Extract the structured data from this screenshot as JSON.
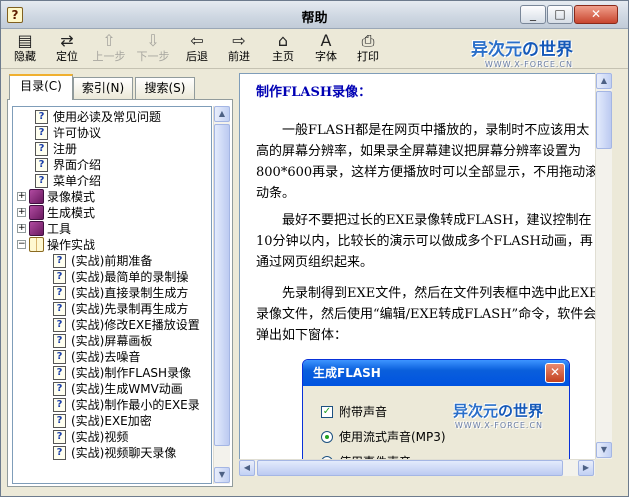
{
  "window": {
    "title": "帮助",
    "minimize": "_",
    "maximize": "□",
    "close": "✕"
  },
  "toolbar": [
    {
      "label": "隐藏",
      "icon": "hide-icon",
      "glyph": "▤",
      "enabled": true
    },
    {
      "label": "定位",
      "icon": "locate-icon",
      "glyph": "⇄",
      "enabled": true
    },
    {
      "label": "上一步",
      "icon": "up-arrow-icon",
      "glyph": "⇧",
      "enabled": false
    },
    {
      "label": "下一步",
      "icon": "down-arrow-icon",
      "glyph": "⇩",
      "enabled": false
    },
    {
      "label": "后退",
      "icon": "back-arrow-icon",
      "glyph": "⇦",
      "enabled": true
    },
    {
      "label": "前进",
      "icon": "forward-arrow-icon",
      "glyph": "⇨",
      "enabled": true
    },
    {
      "label": "主页",
      "icon": "home-icon",
      "glyph": "⌂",
      "enabled": true
    },
    {
      "label": "字体",
      "icon": "font-icon",
      "glyph": "A",
      "enabled": true
    },
    {
      "label": "打印",
      "icon": "printer-icon",
      "glyph": "⎙",
      "enabled": true
    }
  ],
  "watermark": {
    "text_a": "异次元",
    "text_b": "の世界",
    "sub": "WWW.X-FORCE.CN"
  },
  "tabs": [
    {
      "label": "目录(C)",
      "active": true
    },
    {
      "label": "索引(N)",
      "active": false
    },
    {
      "label": "搜索(S)",
      "active": false
    }
  ],
  "tree": [
    {
      "level": 1,
      "type": "page",
      "label": "使用必读及常见问题"
    },
    {
      "level": 1,
      "type": "page",
      "label": "许可协议"
    },
    {
      "level": 1,
      "type": "page",
      "label": "注册"
    },
    {
      "level": 1,
      "type": "page",
      "label": "界面介绍"
    },
    {
      "level": 1,
      "type": "page",
      "label": "菜单介绍"
    },
    {
      "level": 0,
      "type": "book",
      "label": "录像模式",
      "expander": "+"
    },
    {
      "level": 0,
      "type": "book",
      "label": "生成模式",
      "expander": "+"
    },
    {
      "level": 0,
      "type": "book",
      "label": "工具",
      "expander": "+"
    },
    {
      "level": 0,
      "type": "book-open",
      "label": "操作实战",
      "expander": "−"
    },
    {
      "level": 2,
      "type": "page",
      "label": "(实战)前期准备"
    },
    {
      "level": 2,
      "type": "page",
      "label": "(实战)最简单的录制操"
    },
    {
      "level": 2,
      "type": "page",
      "label": "(实战)直接录制生成方"
    },
    {
      "level": 2,
      "type": "page",
      "label": "(实战)先录制再生成方"
    },
    {
      "level": 2,
      "type": "page",
      "label": "(实战)修改EXE播放设置"
    },
    {
      "level": 2,
      "type": "page",
      "label": "(实战)屏幕画板"
    },
    {
      "level": 2,
      "type": "page",
      "label": "(实战)去噪音"
    },
    {
      "level": 2,
      "type": "page",
      "label": "(实战)制作FLASH录像"
    },
    {
      "level": 2,
      "type": "page",
      "label": "(实战)生成WMV动画"
    },
    {
      "level": 2,
      "type": "page",
      "label": "(实战)制作最小的EXE录"
    },
    {
      "level": 2,
      "type": "page",
      "label": "(实战)EXE加密"
    },
    {
      "level": 2,
      "type": "page",
      "label": "(实战)视频"
    },
    {
      "level": 2,
      "type": "page",
      "label": "(实战)视频聊天录像"
    }
  ],
  "content": {
    "title": "制作FLASH录像：",
    "paragraphs": [
      "一般FLASH都是在网页中播放的，录制时不应该用太高的屏幕分辨率，如果录全屏幕建议把屏幕分辨率设置为800*600再录，这样方便播放时可以全部显示，不用拖动滚动条。",
      "最好不要把过长的EXE录像转成FLASH，建议控制在10分钟以内，比较长的演示可以做成多个FLASH动画，再通过网页组织起来。",
      "先录制得到EXE文件，然后在文件列表框中选中此EXE录像文件，然后使用“编辑/EXE转成FLASH”命令，软件会弹出如下窗体："
    ],
    "dialog": {
      "title": "生成FLASH",
      "close": "✕",
      "options": [
        {
          "kind": "checkbox",
          "checked": true,
          "label": "附带声音"
        },
        {
          "kind": "radio",
          "checked": true,
          "label": "使用流式声音(MP3)"
        },
        {
          "kind": "radio",
          "checked": false,
          "label": "使用事件声音"
        }
      ]
    }
  },
  "scroll": {
    "up": "▲",
    "down": "▼",
    "left": "◀",
    "right": "▶"
  }
}
